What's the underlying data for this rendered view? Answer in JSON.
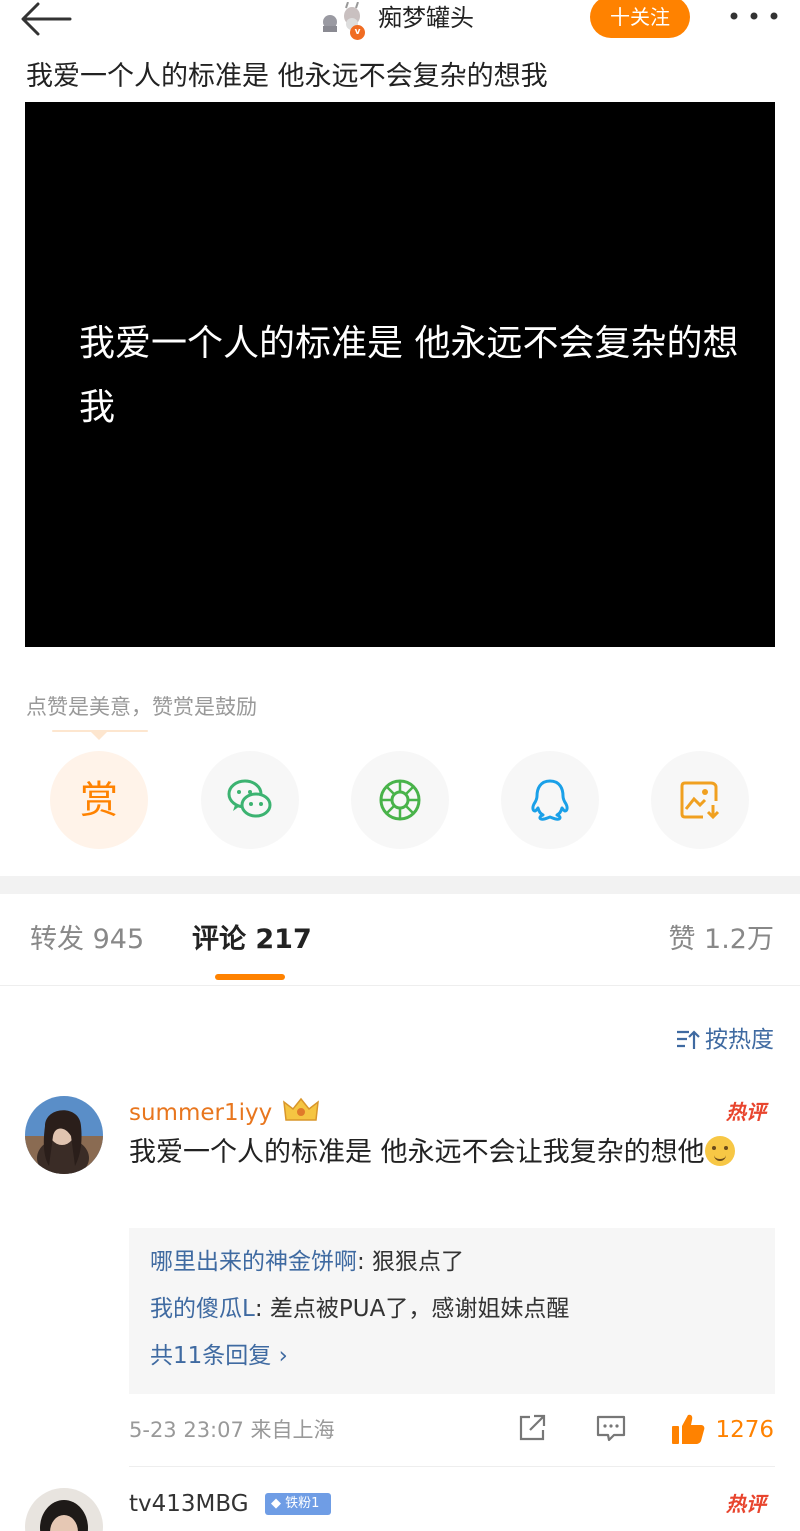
{
  "header": {
    "username": "痴梦罐头",
    "verified_badge": "v",
    "follow_label": "十关注",
    "icons": [
      "back-arrow-icon",
      "more-icon"
    ]
  },
  "post": {
    "text": "我爱一个人的标准是 他永远不会复杂的想我",
    "video_caption": "我爱一个人的标准是 他永远不会复杂的想我"
  },
  "reward": {
    "tip": "点赞是美意，赞赏是鼓励",
    "reward_label": "赏",
    "share_icons": [
      "reward-icon",
      "wechat-icon",
      "moments-icon",
      "qq-icon",
      "save-image-icon"
    ]
  },
  "tabs": {
    "repost": "转发 945",
    "comments": "评论 217",
    "likes": "赞 1.2万"
  },
  "sort_label": "按热度",
  "comments": [
    {
      "username": "summer1iyy",
      "hot_label": "热评",
      "text": "我爱一个人的标准是 他永远不会让我复杂的想他",
      "replies": [
        {
          "user": "哪里出来的神金饼啊",
          "text": ": 狠狠点了"
        },
        {
          "user": "我的傻瓜L",
          "text": ": 差点被PUA了，感谢姐妹点醒"
        }
      ],
      "more_replies": "共11条回复 ›",
      "timestamp": "5-23 23:07",
      "location": "来自上海",
      "like_count": "1276"
    },
    {
      "username": "tv413MBG",
      "fan_badge": "铁粉1",
      "hot_label": "热评"
    }
  ],
  "colors": {
    "accent": "#ff8200",
    "link": "#3f6aa1",
    "hot": "#e8452e"
  }
}
